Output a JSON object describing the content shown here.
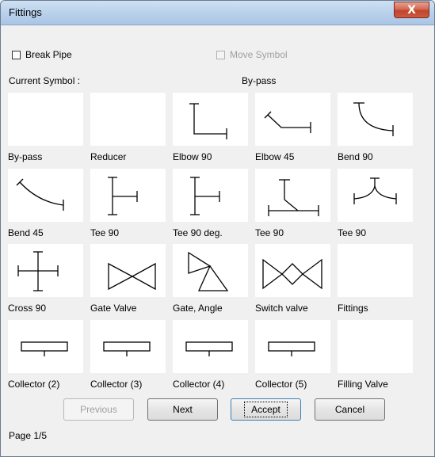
{
  "window": {
    "title": "Fittings",
    "close_glyph": "X"
  },
  "options": {
    "break_pipe": {
      "label": "Break Pipe",
      "checked": false
    },
    "move_symbol": {
      "label": "Move Symbol",
      "checked": false,
      "enabled": false
    }
  },
  "current_symbol": {
    "caption": "Current Symbol :",
    "value": "By-pass"
  },
  "tiles": [
    {
      "label": "By-pass",
      "icon": "blank-icon"
    },
    {
      "label": "Reducer",
      "icon": "blank-icon"
    },
    {
      "label": "Elbow 90",
      "icon": "elbow-90-icon"
    },
    {
      "label": "Elbow 45",
      "icon": "elbow-45-icon"
    },
    {
      "label": "Bend 90",
      "icon": "bend-90-icon"
    },
    {
      "label": "Bend 45",
      "icon": "bend-45-icon"
    },
    {
      "label": "Tee 90",
      "icon": "tee-90-icon"
    },
    {
      "label": "Tee 90 deg.",
      "icon": "tee-90-deg-icon"
    },
    {
      "label": "Tee 90",
      "icon": "tee-45-icon"
    },
    {
      "label": "Tee 90",
      "icon": "tee-y-icon"
    },
    {
      "label": "Cross 90",
      "icon": "cross-90-icon"
    },
    {
      "label": "Gate Valve",
      "icon": "gate-valve-icon"
    },
    {
      "label": "Gate, Angle",
      "icon": "angle-valve-icon"
    },
    {
      "label": "Switch valve",
      "icon": "switch-valve-icon"
    },
    {
      "label": "Fittings",
      "icon": "blank-icon"
    },
    {
      "label": "Collector (2)",
      "icon": "collector-icon"
    },
    {
      "label": "Collector (3)",
      "icon": "collector-icon"
    },
    {
      "label": "Collector (4)",
      "icon": "collector-icon"
    },
    {
      "label": "Collector (5)",
      "icon": "collector-icon"
    },
    {
      "label": "Filling Valve",
      "icon": "blank-icon"
    }
  ],
  "buttons": {
    "previous": {
      "label": "Previous",
      "enabled": false
    },
    "next": {
      "label": "Next",
      "enabled": true
    },
    "accept": {
      "label": "Accept",
      "enabled": true
    },
    "cancel": {
      "label": "Cancel",
      "enabled": true
    }
  },
  "page": {
    "label": "Page 1/5"
  }
}
